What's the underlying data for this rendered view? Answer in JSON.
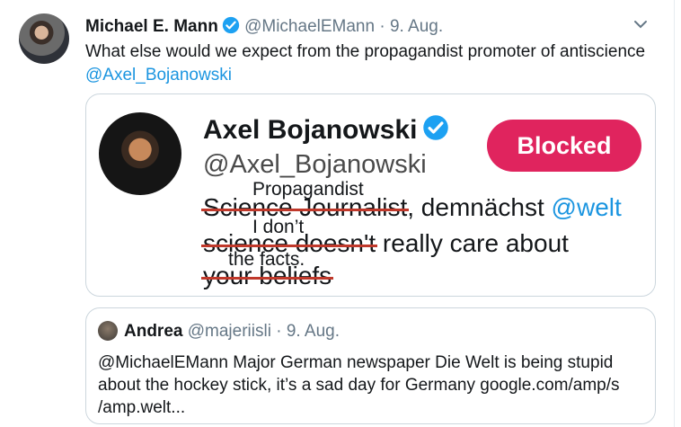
{
  "tweet": {
    "author_name": "Michael E. Mann",
    "author_handle": "@MichaelEMann",
    "separator": "·",
    "date": "9. Aug.",
    "text": "What else would we expect from the propagandist promoter of antiscience",
    "mention": "@Axel_Bojanowski",
    "verified_icon": "verified-badge-icon",
    "menu_icon": "chevron-down-icon"
  },
  "media": {
    "profile_name": "Axel Bojanowski",
    "profile_handle": "@Axel_Bojanowski",
    "blocked_label": "Blocked",
    "line1_struck": "Science Journalist",
    "line1_rest": ", demnächst ",
    "line1_mention": "@welt",
    "line1_overlay": "Propagandist",
    "line2_struck": "science doesn't",
    "line2_rest": " really care about",
    "line2_overlay": "I don’t",
    "line3_struck": "your beliefs",
    "line3_overlay": "the facts.",
    "strike_color": "#c0392b",
    "blocked_color": "#e0245e"
  },
  "quote": {
    "author_name": "Andrea",
    "author_handle": "@majeriisli",
    "separator": "·",
    "date": "9. Aug.",
    "text": "@MichaelEMann Major German newspaper Die Welt is being stupid about the hockey stick, it’s a sad day for Germany google.com/amp/s /amp.welt..."
  }
}
